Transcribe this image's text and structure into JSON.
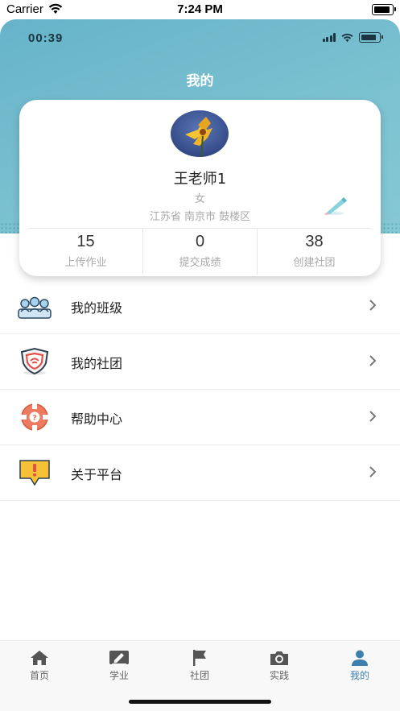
{
  "sim_status": {
    "carrier": "Carrier",
    "time": "7:24 PM"
  },
  "app_status": {
    "time": "00:39"
  },
  "header": {
    "title": "我的"
  },
  "profile": {
    "name": "王老师1",
    "gender": "女",
    "location": "江苏省 南京市 鼓楼区",
    "stats": [
      {
        "value": "15",
        "label": "上传作业"
      },
      {
        "value": "0",
        "label": "提交成绩"
      },
      {
        "value": "38",
        "label": "创建社团"
      }
    ]
  },
  "menu": {
    "items": [
      {
        "label": "我的班级",
        "icon": "class-group-icon"
      },
      {
        "label": "我的社团",
        "icon": "club-shield-icon"
      },
      {
        "label": "帮助中心",
        "icon": "help-center-icon"
      },
      {
        "label": "关于平台",
        "icon": "about-platform-icon"
      }
    ]
  },
  "tabbar": {
    "items": [
      {
        "label": "首页",
        "icon": "home-icon"
      },
      {
        "label": "学业",
        "icon": "study-icon"
      },
      {
        "label": "社团",
        "icon": "flag-icon"
      },
      {
        "label": "实践",
        "icon": "camera-icon"
      },
      {
        "label": "我的",
        "icon": "user-icon",
        "active": true
      }
    ]
  },
  "colors": {
    "accent": "#3e7fae",
    "header_bg": "#72bccd",
    "muted_text": "#aaaaaa"
  }
}
